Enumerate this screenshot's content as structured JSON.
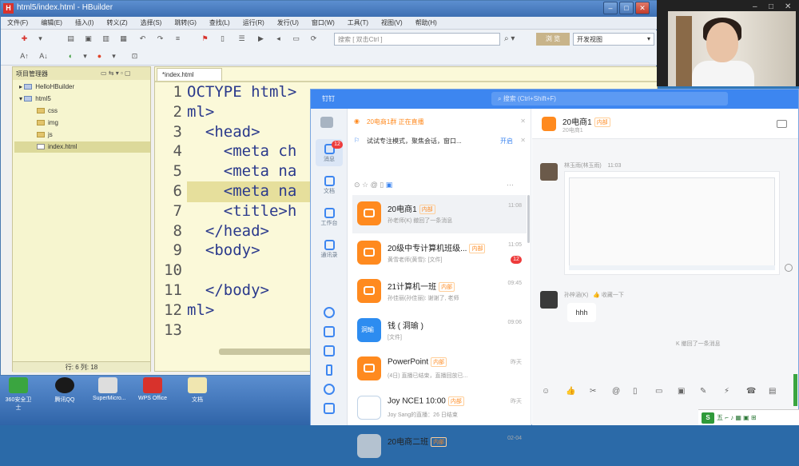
{
  "hbuilder": {
    "title": "html5/index.html - HBuilder",
    "logo": "H",
    "menu": [
      "文件(F)",
      "编辑(E)",
      "插入(I)",
      "转义(Z)",
      "选择(S)",
      "跳转(G)",
      "查找(L)",
      "运行(R)",
      "发行(U)",
      "窗口(W)",
      "工具(T)",
      "视图(V)",
      "帮助(H)"
    ],
    "search_placeholder": "搜索 [ 双击Ctrl ]",
    "preview_label": "浏 览",
    "view_select": "开发视图",
    "project_panel_title": "项目管理器",
    "tree": [
      {
        "label": "HelloHBuilder",
        "type": "project"
      },
      {
        "label": "html5",
        "type": "project"
      },
      {
        "label": "css",
        "type": "folder"
      },
      {
        "label": "img",
        "type": "folder"
      },
      {
        "label": "js",
        "type": "folder"
      },
      {
        "label": "index.html",
        "type": "file",
        "selected": true
      }
    ],
    "status": "行: 6 列: 18",
    "editor_tab": "*index.html",
    "code_lines": [
      {
        "n": "1",
        "text": "OCTYPE html>"
      },
      {
        "n": "2",
        "text": "ml>"
      },
      {
        "n": "3",
        "text": "  <head>"
      },
      {
        "n": "4",
        "text": "    <meta ch"
      },
      {
        "n": "5",
        "text": "    <meta na"
      },
      {
        "n": "6",
        "text": "    <meta na"
      },
      {
        "n": "7",
        "text": "    <title>h"
      },
      {
        "n": "8",
        "text": "  </head>"
      },
      {
        "n": "9",
        "text": "  <body>"
      },
      {
        "n": "10",
        "text": ""
      },
      {
        "n": "11",
        "text": "  </body>"
      },
      {
        "n": "12",
        "text": "ml>"
      },
      {
        "n": "13",
        "text": ""
      }
    ]
  },
  "dingtalk": {
    "logo": "钉钉",
    "search_placeholder": "搜索 (Ctrl+Shift+F)",
    "nav": [
      {
        "label": "消息",
        "badge": "12"
      },
      {
        "label": "文档"
      },
      {
        "label": "工作台"
      },
      {
        "label": "通讯录"
      }
    ],
    "banner_live": "20电商1群 正在直播",
    "banner_tip": "试试专注模式，聚焦会话，窗口...",
    "banner_tip_action": "开启",
    "conversations": [
      {
        "name": "20电商1",
        "tag": "内部",
        "sub": "孙老师(K) 撤回了一条消息",
        "time": "11:08",
        "avatar": "orange",
        "selected": true
      },
      {
        "name": "20级中专计算机班级...",
        "tag": "内部",
        "sub": "黄雪老师(黄雪): [文件]",
        "time": "11:05",
        "avatar": "orange",
        "badge": "12"
      },
      {
        "name": "21计算机一班",
        "tag": "内部",
        "sub": "孙佳丽(孙佳丽): 谢谢了, 老师",
        "time": "09:45",
        "avatar": "orange"
      },
      {
        "name": "钱 ( 洞瑜 )",
        "tag": "",
        "sub": "[文件]",
        "time": "09:06",
        "avatar": "blue",
        "avatar_text": "洞瑜"
      },
      {
        "name": "PowerPoint",
        "tag": "内部",
        "sub": "(4日) 直播已结束，直播回放已...",
        "time": "昨天",
        "avatar": "orange"
      },
      {
        "name": "Joy NCE1 10:00",
        "tag": "内部",
        "sub": "Joy Sang的直播：26 日结束",
        "time": "昨天",
        "avatar": "out"
      },
      {
        "name": "20电商二班",
        "tag": "内部",
        "sub": "",
        "time": "02-04",
        "avatar": "gray"
      }
    ],
    "chat": {
      "title": "20电商1",
      "title_tag": "内部",
      "subtitle": "20电商1",
      "msg1_sender": "林玉雨(林玉雨)",
      "msg1_time": "11:03",
      "msg2_sender": "孙梓涵(K)",
      "msg2_action": "👍 收藏一下",
      "msg2_text": "hhh",
      "recall_notice": "K 撤回了一条消息"
    }
  },
  "taskbar": {
    "icons": [
      "360安全卫士",
      "腾讯QQ",
      "SuperMicro...",
      "WPS Office",
      "文档"
    ]
  },
  "tray": {
    "ime": "S",
    "text": "五 ⌐ ♪ ▦ ▣ ⊞"
  }
}
